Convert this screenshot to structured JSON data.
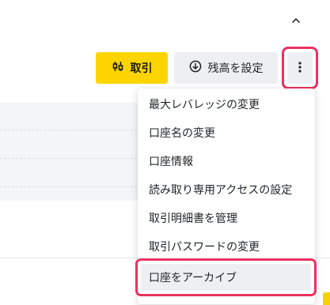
{
  "icons": {
    "collapse": "chevron-up-icon",
    "trade": "sliders-icon",
    "deposit": "download-circle-icon",
    "more": "vertical-dots-icon"
  },
  "colors": {
    "accent_yellow": "#fcd500",
    "highlight_pink": "#ec3160",
    "button_gray": "#edeff2"
  },
  "toolbar": {
    "trade_label": "取引",
    "deposit_label": "残高を設定"
  },
  "menu": {
    "items": [
      {
        "label": "最大レバレッジの変更"
      },
      {
        "label": "口座名の変更"
      },
      {
        "label": "口座情報"
      },
      {
        "label": "読み取り専用アクセスの設定"
      },
      {
        "label": "取引明細書を管理"
      },
      {
        "label": "取引パスワードの変更"
      },
      {
        "label": "口座をアーカイブ"
      }
    ]
  }
}
